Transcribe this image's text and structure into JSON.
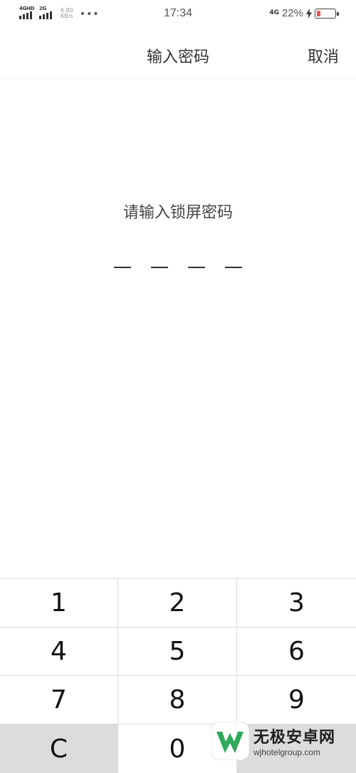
{
  "status_bar": {
    "sim1_label": "4GHD",
    "sim2_label": "2G",
    "speed_value": "6.80",
    "speed_unit": "KB/s",
    "more_dots": "•••",
    "time": "17:34",
    "network": "4G",
    "battery_percent": "22%",
    "battery_level": 0.22,
    "battery_color": "#ef5350"
  },
  "header": {
    "title": "输入密码",
    "cancel_label": "取消"
  },
  "prompt": "请输入锁屏密码",
  "pin_slots": 4,
  "keypad": {
    "keys": [
      "1",
      "2",
      "3",
      "4",
      "5",
      "6",
      "7",
      "8",
      "9",
      "C",
      "0",
      ""
    ]
  },
  "watermark": {
    "brand": "无极安卓网",
    "url": "wjhotelgroup.com",
    "logo_color": "#2eaa5a"
  }
}
